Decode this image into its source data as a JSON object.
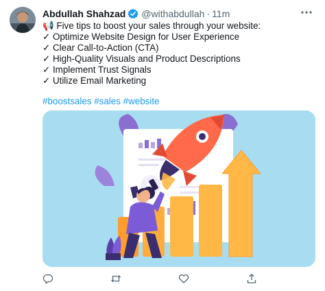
{
  "author": {
    "name": "Abdullah Shahzad",
    "handle": "@withabdullah",
    "separator": "·",
    "time": "11m"
  },
  "tweet": {
    "lines": [
      "📢 Five tips to boost your sales through your website:",
      "✓ Optimize Website Design for User Experience",
      "✓ Clear Call-to-Action (CTA)",
      "✓ High-Quality Visuals and Product Descriptions",
      "✓ Implement Trust Signals",
      "✓ Utilize Email Marketing"
    ],
    "hashtags": [
      "#boostsales",
      "#sales",
      "#website"
    ]
  },
  "icons": {
    "more": "more-options-icon",
    "verified": "verified-badge-icon",
    "reply": "reply-icon",
    "retweet": "retweet-icon",
    "like": "like-icon",
    "share": "share-icon"
  },
  "colors": {
    "accent": "#1d9bf0",
    "text": "#0f1419",
    "muted": "#536471",
    "media_bg": "#a8dcf0"
  }
}
